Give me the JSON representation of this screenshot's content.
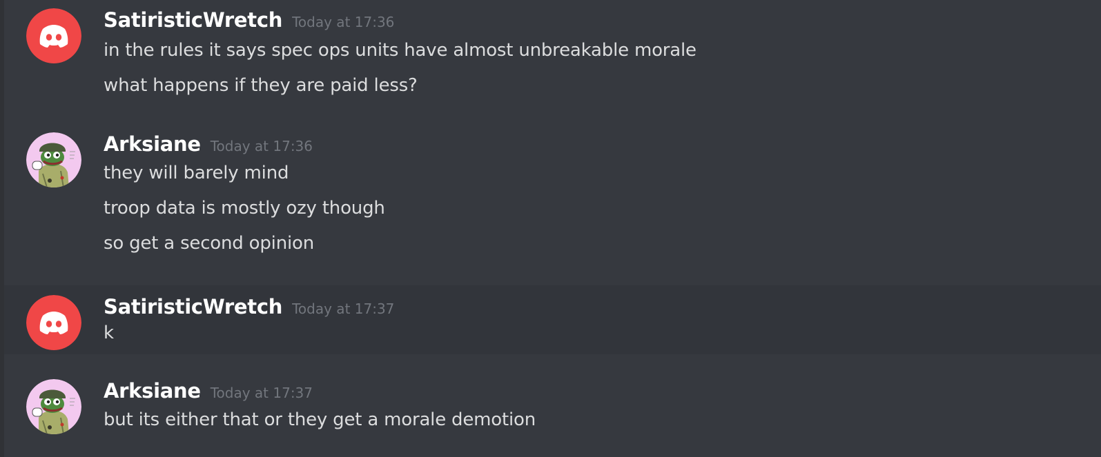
{
  "messages": [
    {
      "author": "SatiristicWretch",
      "timestamp": "Today at 17:36",
      "avatar": "discord-default-avatar",
      "lines": [
        "in the rules it says spec ops units have almost unbreakable morale",
        "what happens if they are paid less?"
      ]
    },
    {
      "author": "Arksiane",
      "timestamp": "Today at 17:36",
      "avatar": "pepe-soldier-avatar",
      "lines": [
        "they will barely mind",
        "troop data is mostly ozy though",
        "so get a second opinion"
      ]
    },
    {
      "author": "SatiristicWretch",
      "timestamp": "Today at 17:37",
      "avatar": "discord-default-avatar",
      "lines": [
        "k"
      ]
    },
    {
      "author": "Arksiane",
      "timestamp": "Today at 17:37",
      "avatar": "pepe-soldier-avatar",
      "lines": [
        "but its either that or they get a morale demotion"
      ]
    }
  ],
  "colors": {
    "background": "#36393f",
    "hover_background": "#32353b",
    "author": "#ffffff",
    "timestamp": "#72767d",
    "message_text": "#dcddde",
    "discord_avatar_red": "#f04747",
    "pepe_avatar_bg": "#f3c9ef"
  }
}
